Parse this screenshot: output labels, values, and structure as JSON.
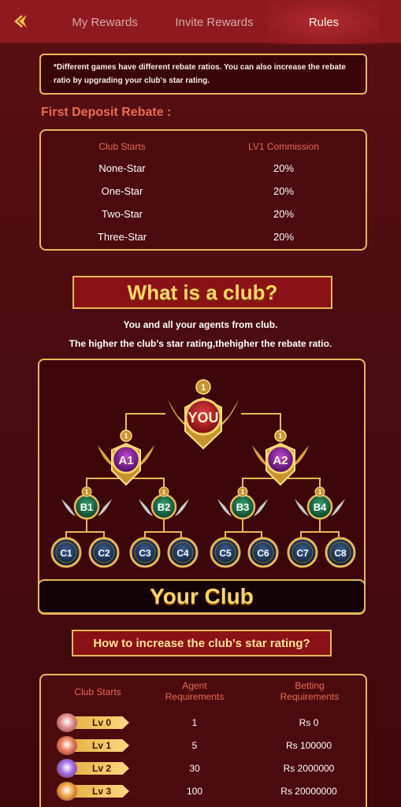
{
  "header": {
    "tabs": [
      {
        "label": "My Rewards"
      },
      {
        "label": "Invite Rewards"
      },
      {
        "label": "Rules"
      }
    ],
    "active_tab": "Rules"
  },
  "note": {
    "text": "*Different games have different rebate ratios. You can also increase the rebate ratio by upgrading your club's star rating."
  },
  "deposit": {
    "title": "First Deposit Rebate :",
    "headers": [
      "Club Starts",
      "LV1 Commission"
    ],
    "rows": [
      [
        "None-Star",
        "20%"
      ],
      [
        "One-Star",
        "20%"
      ],
      [
        "Two-Star",
        "20%"
      ],
      [
        "Three-Star",
        "20%"
      ]
    ]
  },
  "club": {
    "banner": "What is a club?",
    "desc1": "You and all your agents from club.",
    "desc2": "The higher the club's star rating,thehigher the rebate ratio.",
    "nodes": {
      "root": "YOU",
      "level1": [
        "A1",
        "A2"
      ],
      "level2": [
        "B1",
        "B2",
        "B3",
        "B4"
      ],
      "level3": [
        "C1",
        "C2",
        "C3",
        "C4",
        "C5",
        "C6",
        "C7",
        "C8"
      ],
      "badge_number": "1"
    },
    "your_club": "Your Club"
  },
  "star": {
    "banner": "How to increase the club's star rating?",
    "headers": [
      "Club Starts",
      "Agent Requirements",
      "Betting Requirements"
    ],
    "rows": [
      {
        "level": "Lv 0",
        "agents": "1",
        "betting": "Rs 0",
        "gem": "#e08a8a"
      },
      {
        "level": "Lv 1",
        "agents": "5",
        "betting": "Rs 100000",
        "gem": "#e87a5a"
      },
      {
        "level": "Lv 2",
        "agents": "30",
        "betting": "Rs 2000000",
        "gem": "#a06ae0"
      },
      {
        "level": "Lv 3",
        "agents": "100",
        "betting": "Rs 20000000",
        "gem": "#f0a040"
      }
    ]
  },
  "colors": {
    "accent_gold": "#e8b85a",
    "title_orange": "#ea6b53",
    "banner_red": "#8a1216"
  }
}
